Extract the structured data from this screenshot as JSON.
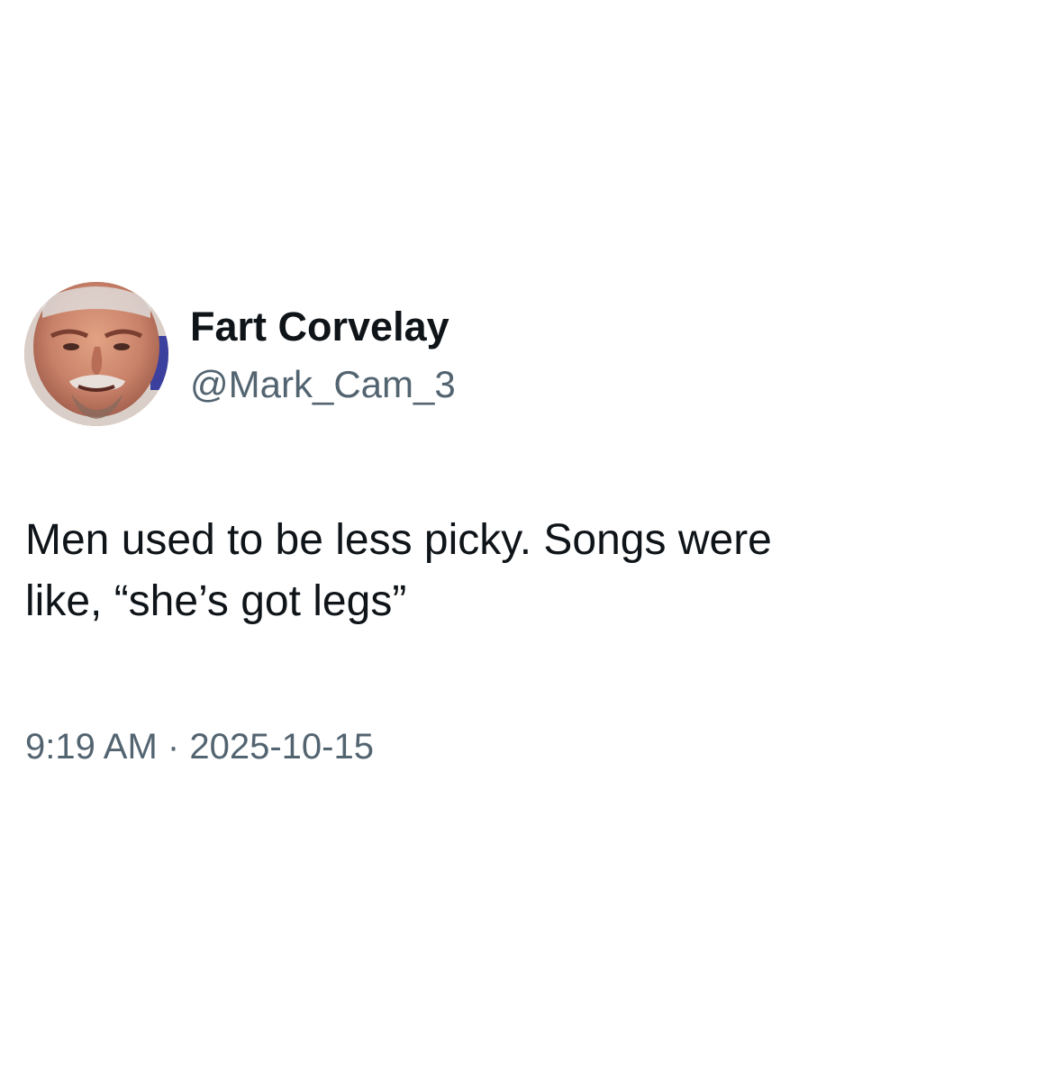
{
  "author": {
    "display_name": "Fart Corvelay",
    "handle": "@Mark_Cam_3",
    "avatar_icon": "profile-photo"
  },
  "tweet": {
    "text_lines": [
      "Men used to be less picky. Songs were",
      "like, “she’s got legs”"
    ]
  },
  "meta": {
    "time": "9:19 AM",
    "separator": "·",
    "date": "2025-10-15"
  },
  "colors": {
    "text_primary": "#0f1419",
    "text_secondary": "#536471",
    "background": "#ffffff"
  }
}
